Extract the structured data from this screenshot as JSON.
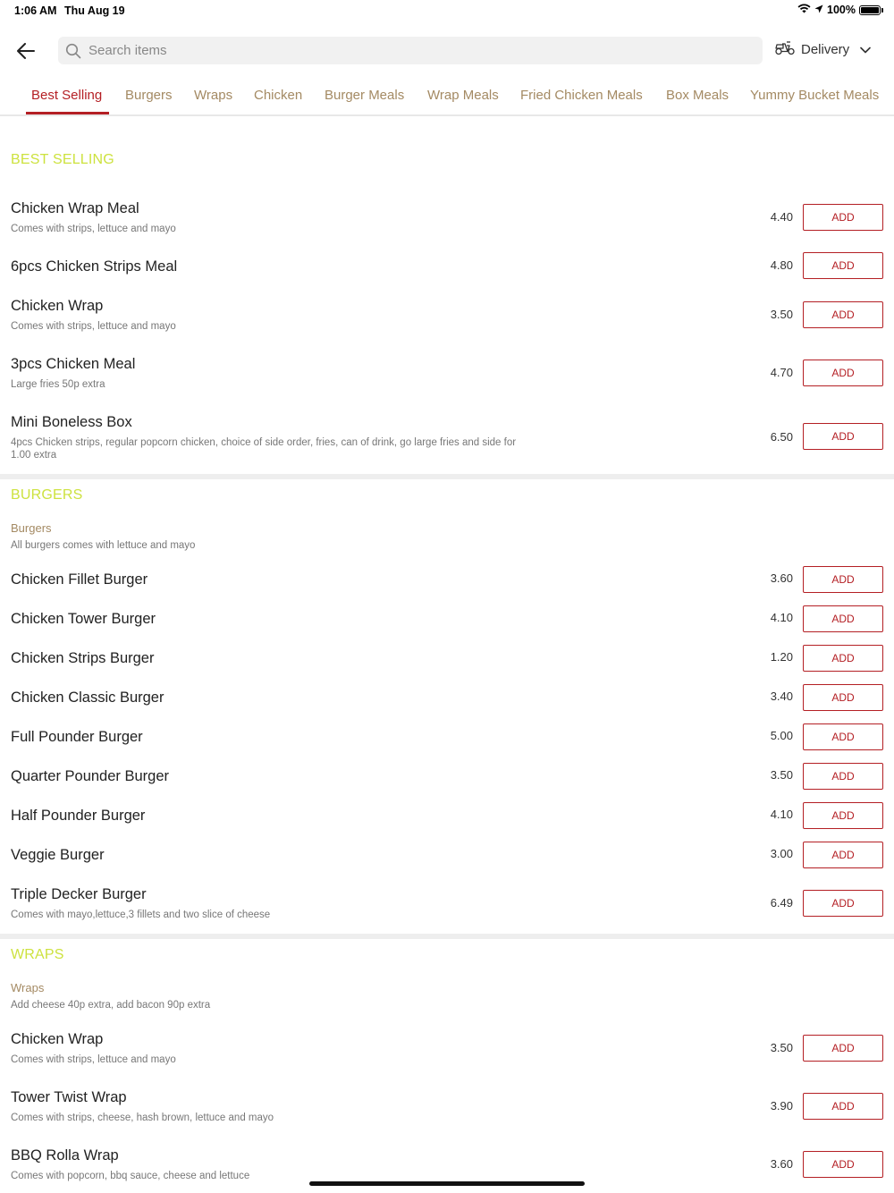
{
  "status": {
    "time": "1:06 AM",
    "date": "Thu Aug 19",
    "battery": "100%"
  },
  "header": {
    "search_placeholder": "Search items",
    "delivery_label": "Delivery"
  },
  "tabs": [
    {
      "label": "Best Selling",
      "active": true
    },
    {
      "label": "Burgers"
    },
    {
      "label": "Wraps"
    },
    {
      "label": "Chicken"
    },
    {
      "label": "Burger Meals"
    },
    {
      "label": "Wrap Meals"
    },
    {
      "label": "Fried Chicken Meals"
    },
    {
      "label": "Box Meals"
    },
    {
      "label": "Yummy Bucket Meals"
    }
  ],
  "add_label": "ADD",
  "sections": {
    "best_selling": {
      "title": "BEST SELLING",
      "items": [
        {
          "name": "Chicken Wrap Meal",
          "desc": "Comes with strips, lettuce and mayo",
          "price": "4.40"
        },
        {
          "name": "6pcs Chicken Strips Meal",
          "desc": "",
          "price": "4.80"
        },
        {
          "name": "Chicken Wrap",
          "desc": "Comes with strips, lettuce and mayo",
          "price": "3.50"
        },
        {
          "name": "3pcs Chicken Meal",
          "desc": "Large fries 50p extra",
          "price": "4.70"
        },
        {
          "name": "Mini Boneless Box",
          "desc": "4pcs Chicken strips, regular popcorn chicken, choice of side order, fries, can of drink, go large fries and side for 1.00 extra",
          "price": "6.50"
        }
      ]
    },
    "burgers": {
      "title": "BURGERS",
      "sub_heading": "Burgers",
      "sub_desc": "All burgers comes with lettuce and mayo",
      "items": [
        {
          "name": "Chicken Fillet Burger",
          "desc": "",
          "price": "3.60"
        },
        {
          "name": "Chicken Tower Burger",
          "desc": "",
          "price": "4.10"
        },
        {
          "name": "Chicken Strips Burger",
          "desc": "",
          "price": "1.20"
        },
        {
          "name": "Chicken Classic Burger",
          "desc": "",
          "price": "3.40"
        },
        {
          "name": "Full Pounder Burger",
          "desc": "",
          "price": "5.00"
        },
        {
          "name": "Quarter Pounder Burger",
          "desc": "",
          "price": "3.50"
        },
        {
          "name": "Half Pounder Burger",
          "desc": "",
          "price": "4.10"
        },
        {
          "name": "Veggie Burger",
          "desc": "",
          "price": "3.00"
        },
        {
          "name": "Triple Decker Burger",
          "desc": "Comes with mayo,lettuce,3 fillets and two slice of cheese",
          "price": "6.49"
        }
      ]
    },
    "wraps": {
      "title": "WRAPS",
      "sub_heading": "Wraps",
      "sub_desc": "Add cheese 40p extra, add bacon 90p extra",
      "items": [
        {
          "name": "Chicken Wrap",
          "desc": "Comes with strips, lettuce and mayo",
          "price": "3.50"
        },
        {
          "name": "Tower Twist Wrap",
          "desc": "Comes with strips, cheese, hash brown, lettuce and mayo",
          "price": "3.90"
        },
        {
          "name": "BBQ Rolla Wrap",
          "desc": "Comes with popcorn, bbq sauce, cheese and lettuce",
          "price": "3.60"
        }
      ]
    }
  },
  "colors": {
    "accent": "#b41f24",
    "section_title": "#cde23f",
    "tab_text": "#a48a63"
  }
}
